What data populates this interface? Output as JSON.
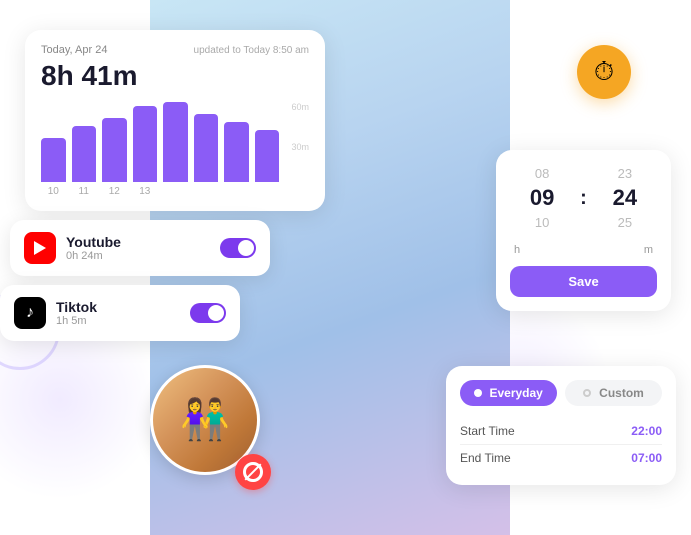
{
  "chart": {
    "date": "Today, Apr 24",
    "updated": "updated to Today 8:50 am",
    "total_time": "8h 41m",
    "y_labels": [
      "60m",
      "30m",
      ""
    ],
    "x_labels": [
      "10",
      "11",
      "12",
      "13"
    ],
    "bars": [
      55,
      70,
      80,
      90,
      95,
      85,
      75,
      65
    ]
  },
  "youtube": {
    "name": "Youtube",
    "time": "0h 24m",
    "icon_label": "▶"
  },
  "tiktok": {
    "name": "Tiktok",
    "time": "1h 5m",
    "icon_label": "♪"
  },
  "timepicker": {
    "hour_prev": "08",
    "hour_current": "09",
    "hour_suffix": "h",
    "hour_next": "10",
    "min_prev": "23",
    "min_current": "24",
    "min_suffix": "m",
    "min_next": "25",
    "save_label": "Save"
  },
  "clock_icon": "⏱",
  "schedule": {
    "tab_everyday": "Everyday",
    "tab_custom": "Custom",
    "start_time_label": "Start Time",
    "start_time_value": "22:00",
    "end_time_label": "End Time",
    "end_time_value": "07:00"
  }
}
